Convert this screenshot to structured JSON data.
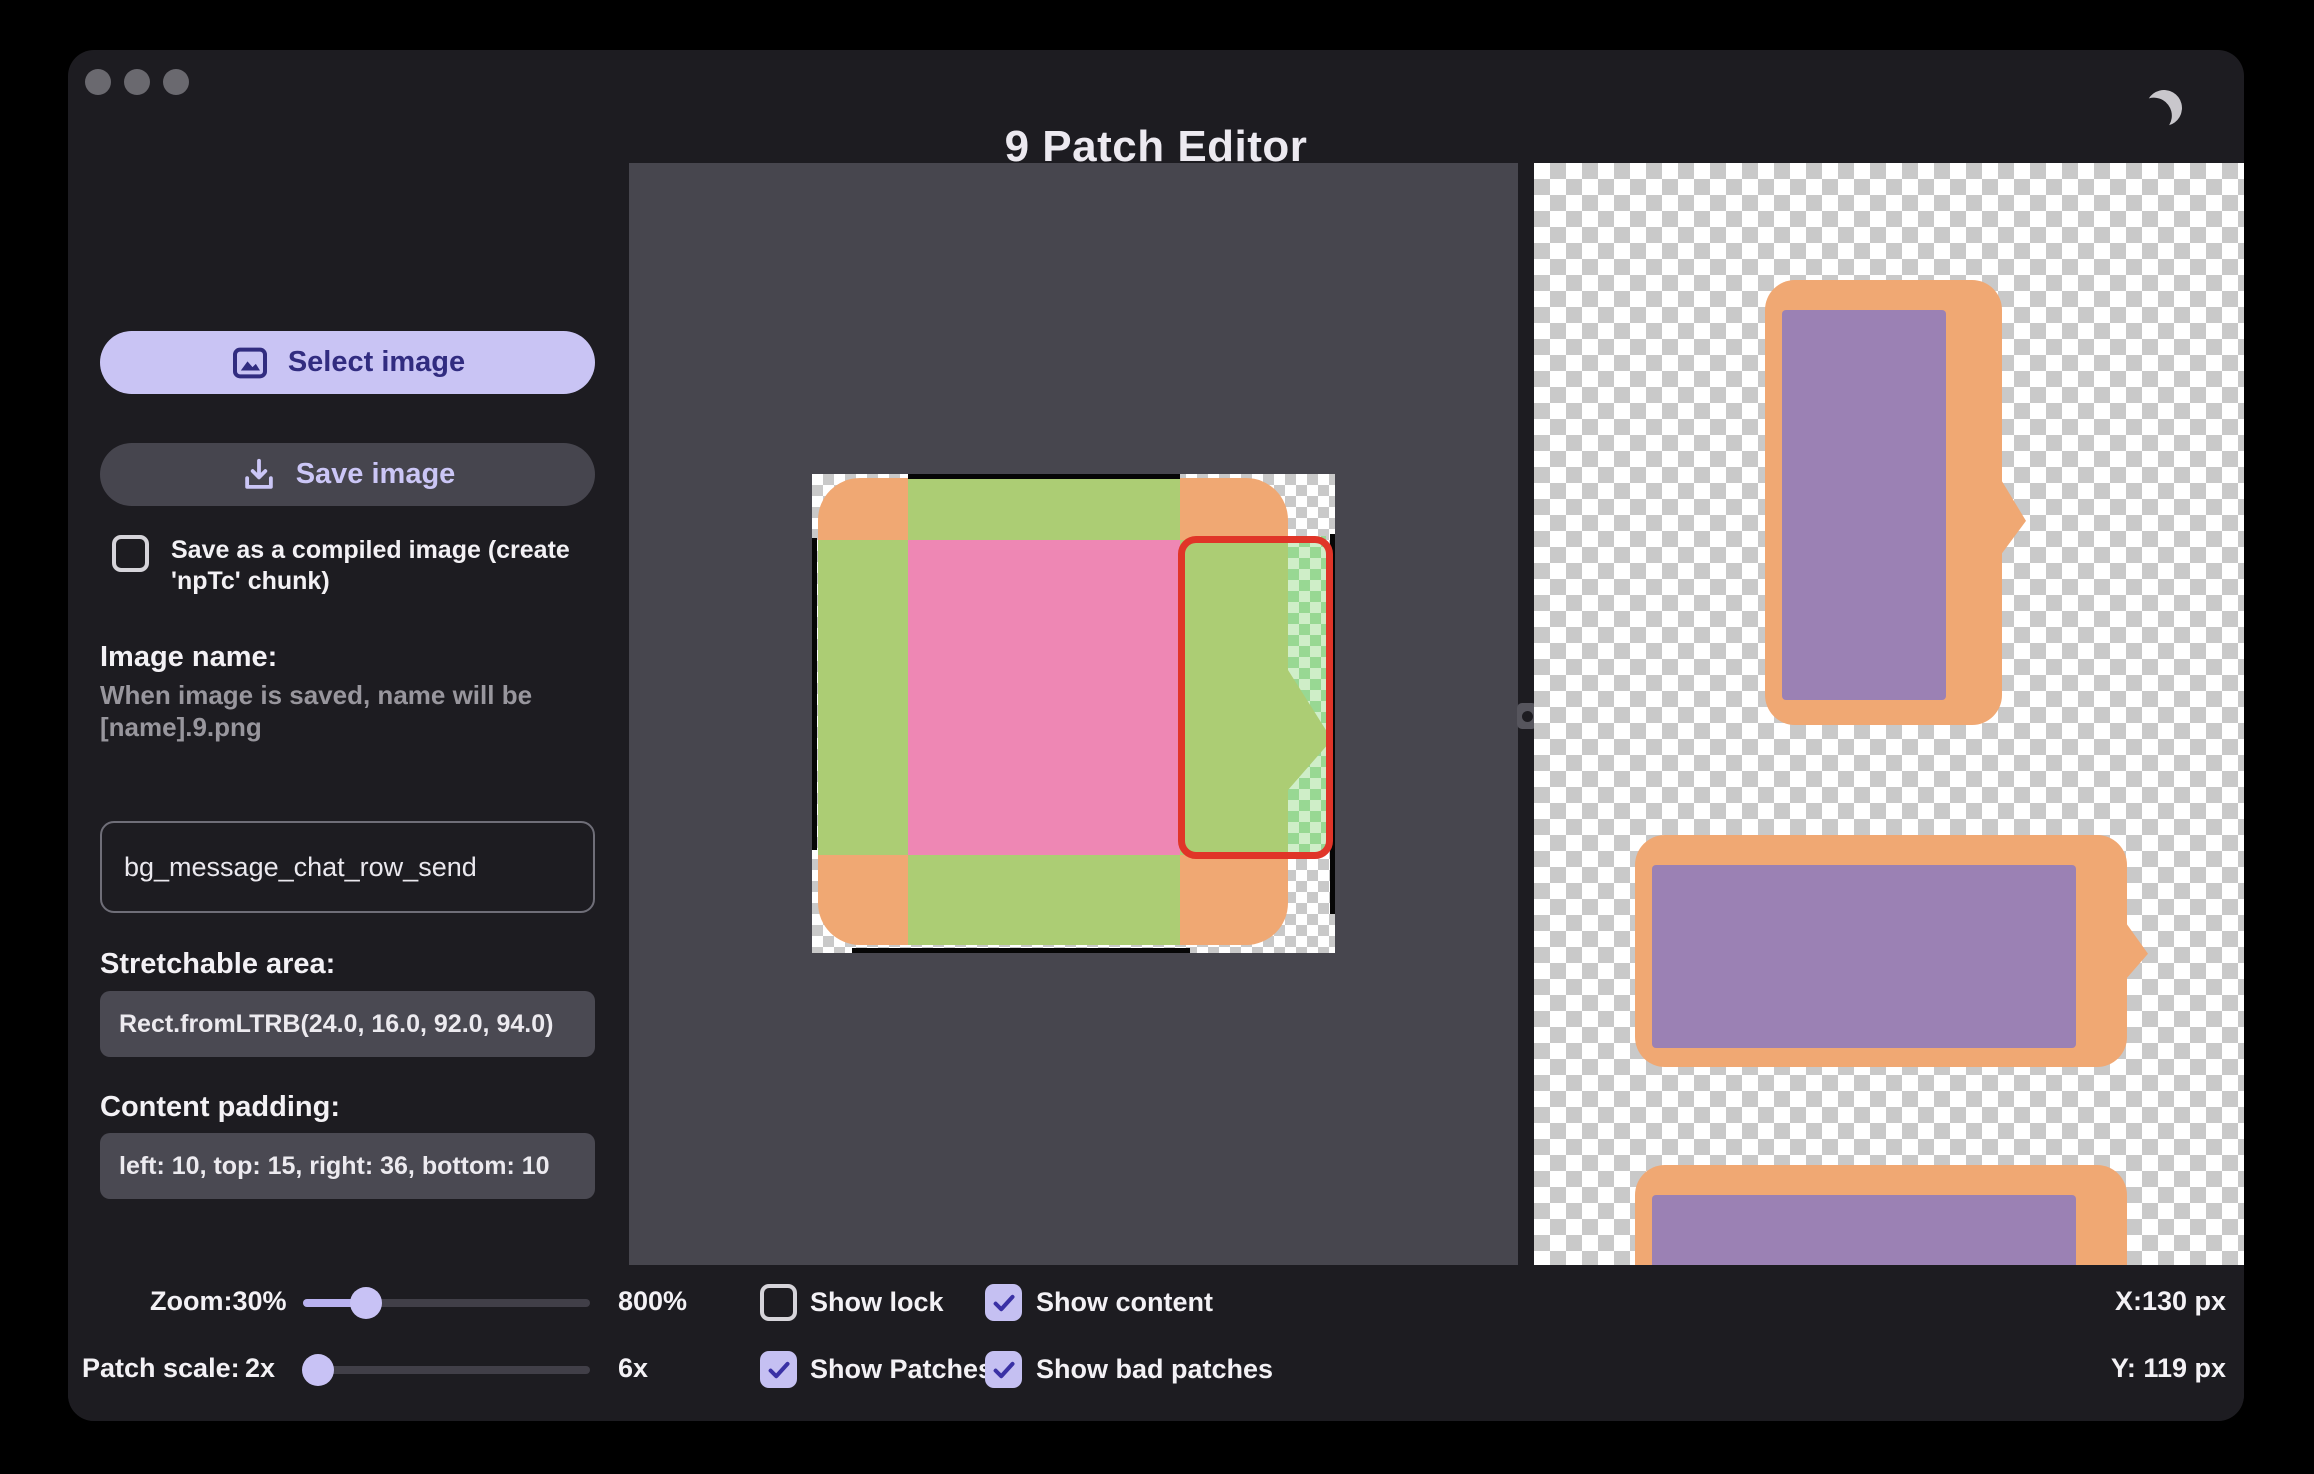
{
  "window": {
    "title": "9 Patch Editor"
  },
  "icons": {
    "theme_toggle": "moon-icon",
    "select_button": "image-icon",
    "save_button": "download-icon",
    "checkbox": "check-icon",
    "divider": "drag-handle-icon"
  },
  "sidebar": {
    "select_image_label": "Select image",
    "save_image_label": "Save image",
    "compile_checkbox": {
      "label": "Save as a compiled image (create 'npTc' chunk)",
      "checked": false
    },
    "image_name_heading": "Image name:",
    "image_name_hint": "When image is saved, name will be [name].9.png",
    "image_name_value": "bg_message_chat_row_send",
    "stretchable_heading": "Stretchable area:",
    "stretchable_value": "Rect.fromLTRB(24.0, 16.0, 92.0, 94.0)",
    "padding_heading": "Content padding:",
    "padding_value": "left: 10, top: 15, right: 36, bottom: 10"
  },
  "statusbar": {
    "zoom_label": "Zoom:30%",
    "zoom_max": "800%",
    "patch_scale_label": "Patch scale:",
    "patch_scale_value": "2x",
    "patch_scale_max": "6x",
    "checkboxes": [
      {
        "label": "Show lock",
        "checked": false
      },
      {
        "label": "Show content",
        "checked": true
      },
      {
        "label": "Show Patches",
        "checked": true
      },
      {
        "label": "Show bad patches",
        "checked": true
      }
    ],
    "cursor_x": "X:130 px",
    "cursor_y": "Y: 119 px"
  },
  "colors": {
    "accent_lavender": "#c9c4f4",
    "accent_indigo": "#312c80",
    "patch_stretch_green": "#accd74",
    "patch_content_pink": "#ee87b4",
    "bubble_orange": "#f0a873",
    "preview_content_purple": "#9b81b4",
    "bad_patch_red": "#e03528",
    "canvas_background": "#47464e",
    "window_background": "#1d1c21"
  }
}
